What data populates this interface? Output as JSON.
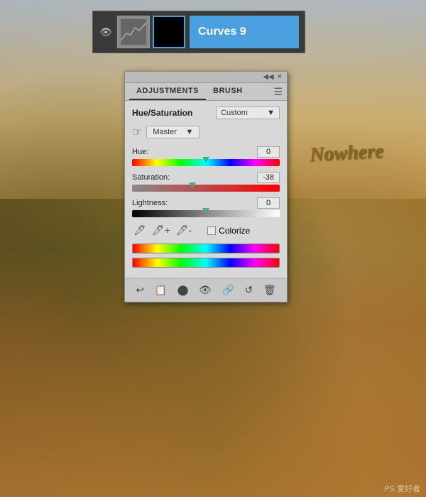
{
  "background": {
    "sky_color": "#b8c8d8",
    "ground_color": "#a07830"
  },
  "layers_bar": {
    "layer_name": "Curves 9",
    "visibility_icon": "👁",
    "background_color": "#4a9fdf"
  },
  "adjustments_panel": {
    "tab_adjustments": "ADJUSTMENTS",
    "tab_brush": "BRUSH",
    "title": "Hue/Saturation",
    "preset_label": "Custom",
    "channel_label": "Master",
    "hue_label": "Hue:",
    "hue_value": "0",
    "saturation_label": "Saturation:",
    "saturation_value": "-38",
    "lightness_label": "Lightness:",
    "lightness_value": "0",
    "colorize_label": "Colorize",
    "hue_thumb_pct": 50,
    "sat_thumb_pct": 41,
    "light_thumb_pct": 50,
    "toolbar_buttons": [
      "↩",
      "📋",
      "🔵",
      "👁",
      "🔗",
      "↺",
      "🗑"
    ]
  },
  "scene": {
    "sign_text": "Nowhere"
  },
  "watermark": "PS 爱好者"
}
